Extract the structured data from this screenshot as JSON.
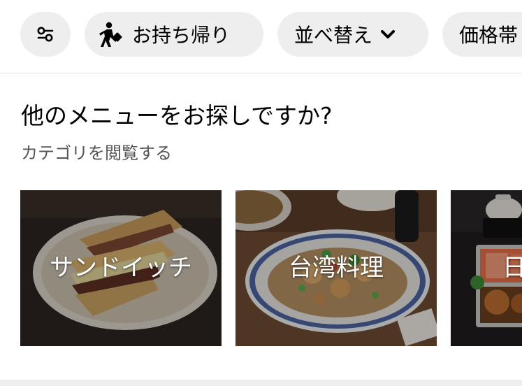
{
  "filters": {
    "takeout_label": "お持ち帰り",
    "sort_label": "並べ替え",
    "price_label": "価格帯"
  },
  "section": {
    "title": "他のメニューをお探しですか?",
    "subtitle": "カテゴリを閲覧する"
  },
  "categories": [
    {
      "label": "サンドイッチ"
    },
    {
      "label": "台湾料理"
    },
    {
      "label": "日"
    }
  ],
  "icons": {
    "filter": "sliders-icon",
    "takeout": "walking-person-icon",
    "sort_chevron": "chevron-down-icon"
  }
}
